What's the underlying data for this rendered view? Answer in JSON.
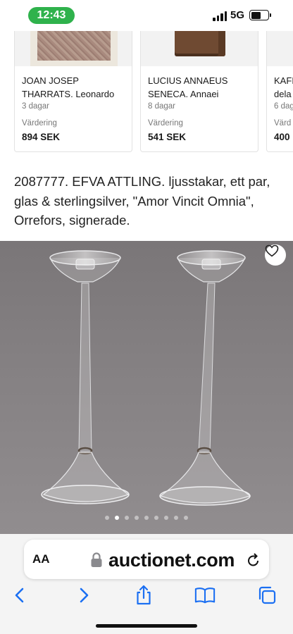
{
  "status_bar": {
    "time": "12:43",
    "network": "5G",
    "time_pill_color": "#2fb24c"
  },
  "cards": [
    {
      "title": "JOAN JOSEP\nTHARRATS. Leonardo",
      "age": "3 dagar",
      "valuation_label": "Värdering",
      "price": "894 SEK"
    },
    {
      "title": "LUCIUS ANNAEUS\nSENECA. Annaei",
      "age": "8 dagar",
      "valuation_label": "Värdering",
      "price": "541 SEK"
    },
    {
      "title": "KAFI\ndela",
      "age": "6 dag",
      "valuation_label": "Värd",
      "price": "400"
    }
  ],
  "lot": {
    "title": "2087777. EFVA ATTLING. ljusstakar, ett par, glas & sterlingsilver, \"Amor Vincit Omnia\", Orrefors, signerade."
  },
  "gallery": {
    "favorite_icon": "heart-icon",
    "dot_count": 9,
    "active_dot": 1
  },
  "browser": {
    "text_size_label": "AA",
    "url": "auctionet.com",
    "lock_icon": "lock-icon",
    "reload_icon": "reload-icon",
    "toolbar": [
      "back-icon",
      "forward-icon",
      "share-icon",
      "bookmarks-icon",
      "tabs-icon"
    ],
    "accent_color": "#1b6ff2"
  }
}
